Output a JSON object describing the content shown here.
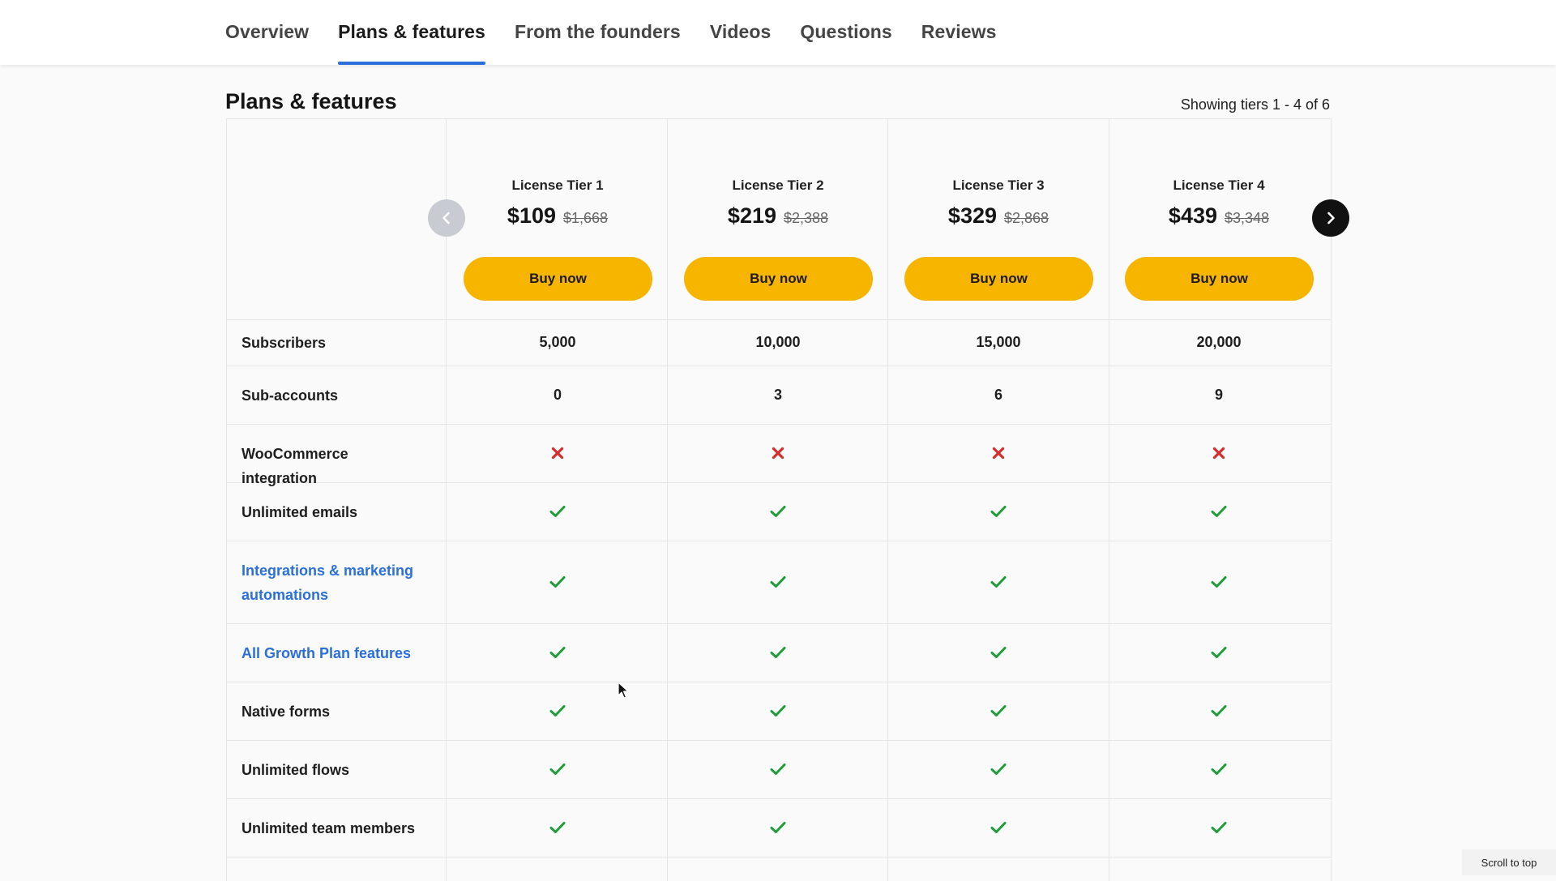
{
  "nav": {
    "tabs": [
      {
        "label": "Overview",
        "active": false
      },
      {
        "label": "Plans & features",
        "active": true
      },
      {
        "label": "From the founders",
        "active": false
      },
      {
        "label": "Videos",
        "active": false
      },
      {
        "label": "Questions",
        "active": false
      },
      {
        "label": "Reviews",
        "active": false
      }
    ],
    "accent_color": "#2a6fdb"
  },
  "section": {
    "title": "Plans & features",
    "tier_count": "Showing tiers 1 - 4 of 6"
  },
  "tiers": [
    {
      "name": "License Tier 1",
      "price": "$109",
      "original_price": "$1,668",
      "button": "Buy now"
    },
    {
      "name": "License Tier 2",
      "price": "$219",
      "original_price": "$2,388",
      "button": "Buy now"
    },
    {
      "name": "License Tier 3",
      "price": "$329",
      "original_price": "$2,868",
      "button": "Buy now"
    },
    {
      "name": "License Tier 4",
      "price": "$439",
      "original_price": "$3,348",
      "button": "Buy now"
    }
  ],
  "carousel": {
    "prev_icon": "chevron-left-icon",
    "next_icon": "chevron-right-icon"
  },
  "features": [
    {
      "label": "Subscribers",
      "link": false,
      "values": [
        "5,000",
        "10,000",
        "15,000",
        "20,000"
      ]
    },
    {
      "label": "Sub-accounts",
      "link": false,
      "values": [
        "0",
        "3",
        "6",
        "9"
      ]
    },
    {
      "label": "WooCommerce integration",
      "link": false,
      "values": [
        "cross",
        "cross",
        "cross",
        "cross"
      ]
    },
    {
      "label": "Unlimited emails",
      "link": false,
      "values": [
        "check",
        "check",
        "check",
        "check"
      ]
    },
    {
      "label": "Integrations & marketing automations",
      "link": true,
      "values": [
        "check",
        "check",
        "check",
        "check"
      ]
    },
    {
      "label": "All Growth Plan features",
      "link": true,
      "values": [
        "check",
        "check",
        "check",
        "check"
      ]
    },
    {
      "label": "Native forms",
      "link": false,
      "values": [
        "check",
        "check",
        "check",
        "check"
      ]
    },
    {
      "label": "Unlimited flows",
      "link": false,
      "values": [
        "check",
        "check",
        "check",
        "check"
      ]
    },
    {
      "label": "Unlimited team members",
      "link": false,
      "values": [
        "check",
        "check",
        "check",
        "check"
      ]
    }
  ],
  "colors": {
    "button": "#f7b500",
    "check": "#1f9d3a",
    "cross": "#d62c2c",
    "link": "#2a6fdb"
  },
  "scroll_top": "Scroll to top"
}
